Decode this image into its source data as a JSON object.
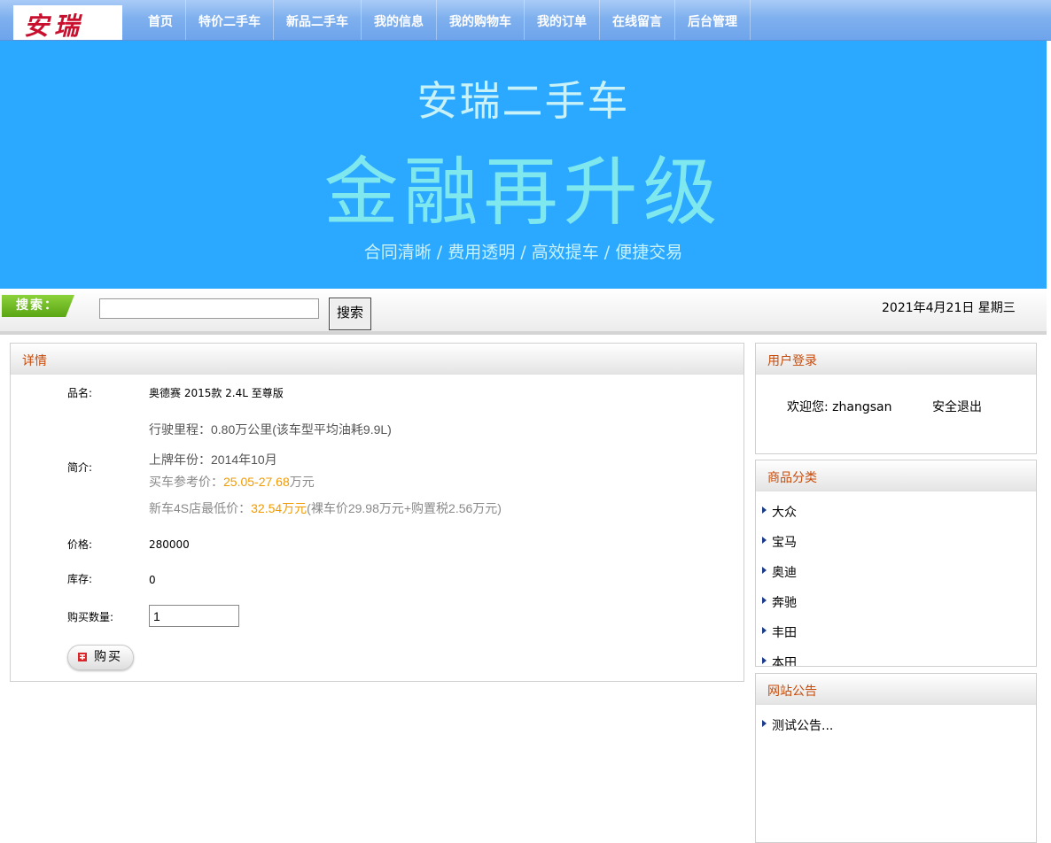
{
  "header": {
    "logo_text": "安瑞",
    "nav": [
      "首页",
      "特价二手车",
      "新品二手车",
      "我的信息",
      "我的购物车",
      "我的订单",
      "在线留言",
      "后台管理"
    ]
  },
  "banner": {
    "line1": "安瑞二手车",
    "line2": "金融再升级",
    "line3": "合同清晰 / 费用透明 / 高效提车 /  便捷交易"
  },
  "search": {
    "tag": "搜索：",
    "input_value": "",
    "button": "搜索",
    "date": "2021年4月21日 星期三"
  },
  "detail": {
    "title": "详情",
    "name_label": "品名:",
    "name_value": "奥德赛 2015款 2.4L 至尊版",
    "intro_label": "简介:",
    "intro": {
      "mileage": "行驶里程：0.80万公里(该车型平均油耗9.9L)",
      "plate": "上牌年份：2014年10月",
      "ref_label": "买车参考价：",
      "ref_price": "25.05-27.68",
      "ref_unit": "万元",
      "new_label": "新车4S店最低价：",
      "new_price": "32.54万元",
      "new_rest": "(裸车价29.98万元+购置税2.56万元)"
    },
    "price_label": "价格:",
    "price_value": "280000",
    "stock_label": "库存:",
    "stock_value": "0",
    "qty_label": "购买数量:",
    "qty_value": "1",
    "buy_button": "购买"
  },
  "login": {
    "title": "用户登录",
    "welcome": "欢迎您: zhangsan",
    "logout": "安全退出"
  },
  "categories": {
    "title": "商品分类",
    "items": [
      "大众",
      "宝马",
      "奥迪",
      "奔驰",
      "丰田",
      "本田"
    ]
  },
  "notice": {
    "title": "网站公告",
    "items": [
      "测试公告..."
    ]
  },
  "colors": {
    "nav_bg": "#7fb0ee",
    "banner_bg": "#2ba8ff",
    "panel_title": "#c74b0a",
    "price_orange": "#f29b00",
    "logo_red": "#c8102e"
  }
}
